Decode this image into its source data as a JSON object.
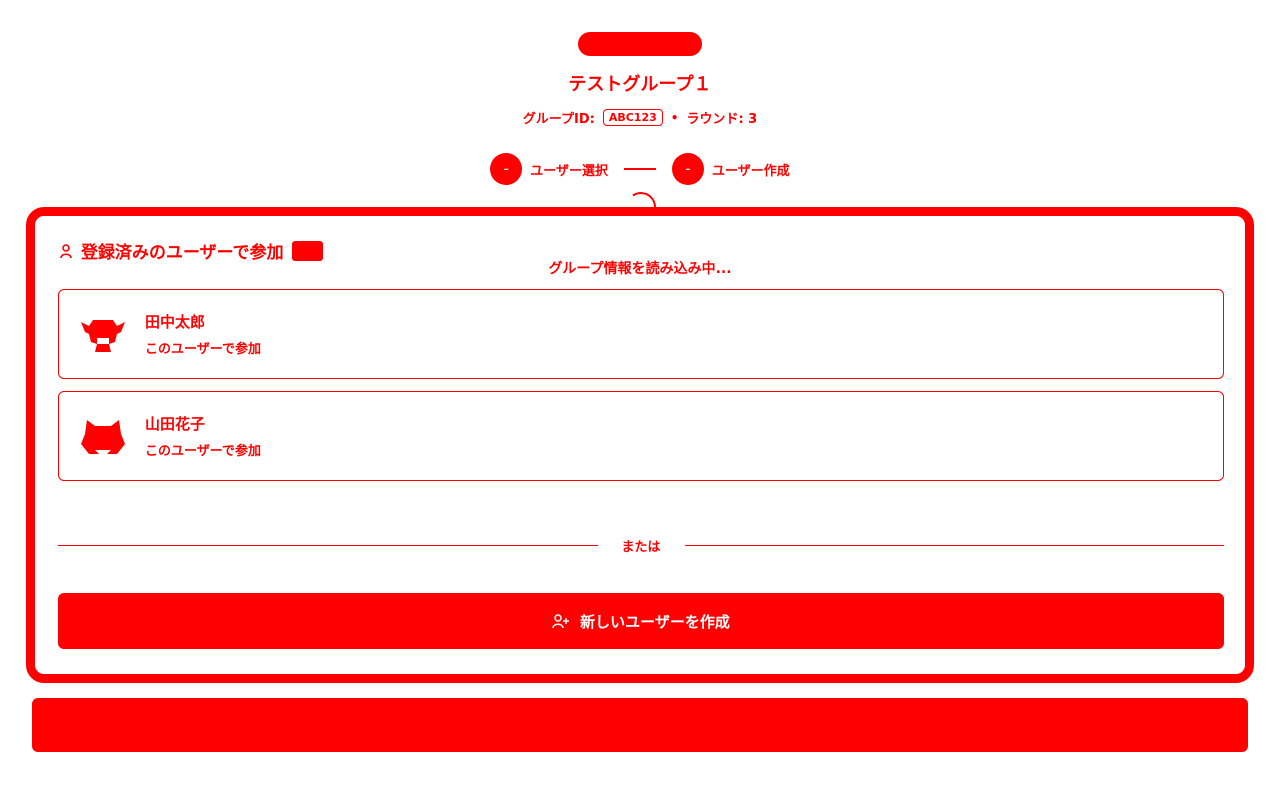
{
  "group": {
    "title": "テストグループ１",
    "id_label": "グループID:",
    "id_value": "ABC123",
    "separator": "•",
    "round_label": "ラウンド: 3"
  },
  "steps": [
    {
      "label": "ユーザー選択"
    },
    {
      "label": "ユーザー作成"
    }
  ],
  "card": {
    "header": "登録済みのユーザーで参加",
    "loading_text": "グループ情報を読み込み中...",
    "users": [
      {
        "name": "田中太郎",
        "action": "このユーザーで参加",
        "avatar": "cow-avatar-icon"
      },
      {
        "name": "山田花子",
        "action": "このユーザーで参加",
        "avatar": "cat-avatar-icon"
      }
    ],
    "divider_text": "または",
    "create_button_label": "新しいユーザーを作成"
  },
  "colors": {
    "accent": "#ff0000",
    "background": "#ffffff"
  }
}
